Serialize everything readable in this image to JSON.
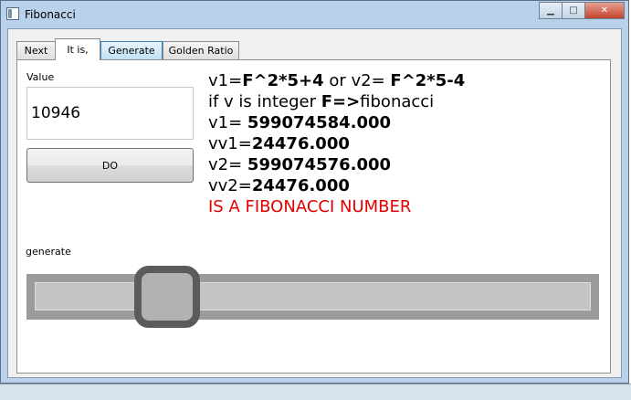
{
  "window": {
    "title": "Fibonacci",
    "minimize_glyph": "▁",
    "maximize_glyph": "□",
    "close_glyph": "✕"
  },
  "tabs": [
    {
      "label": "Next"
    },
    {
      "label": "It is,"
    },
    {
      "label": "Generate"
    },
    {
      "label": "Golden Ratio"
    }
  ],
  "active_tab": "It is,",
  "value_section": {
    "label": "Value",
    "value": "10946",
    "button_label": "DO"
  },
  "results": {
    "line1": {
      "a": "v1=",
      "b": "F^2*5+4",
      "c": " or v2= ",
      "d": "F^2*5-4"
    },
    "line2": {
      "a": "if v is integer ",
      "b": "F=>",
      "c": "fibonacci"
    },
    "line3": {
      "a": "v1= ",
      "b": "599074584.000"
    },
    "line4": {
      "a": "vv1=",
      "b": "24476.000"
    },
    "line5": {
      "a": "v2= ",
      "b": "599074576.000"
    },
    "line6": {
      "a": "vv2=",
      "b": "24476.000"
    },
    "verdict": "IS A FIBONACCI NUMBER"
  },
  "generate_section": {
    "label": "generate"
  },
  "slider": {
    "level": 0.2
  },
  "colors": {
    "verdict": "#e60000",
    "title_bar": "#b9d1ea",
    "close_button": "#c4432e"
  }
}
